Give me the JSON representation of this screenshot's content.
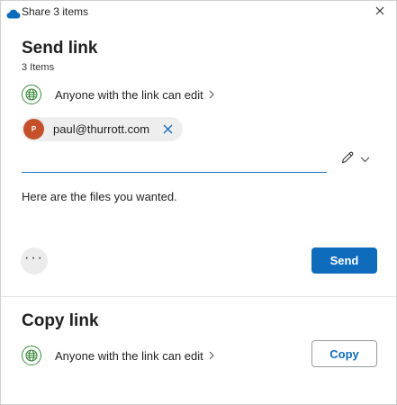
{
  "window": {
    "title": "Share 3 items"
  },
  "send_link": {
    "heading": "Send link",
    "items_count": "3 Items",
    "permission": "Anyone with the link can edit",
    "recipient": {
      "initial": "P",
      "email": "paul@thurrott.com"
    },
    "to_field_value": "",
    "message": "Here are the files you wanted.",
    "more_label": "···",
    "send_label": "Send"
  },
  "copy_link": {
    "heading": "Copy link",
    "permission": "Anyone with the link can edit",
    "copy_label": "Copy"
  },
  "icons": {
    "app": "onedrive-cloud-icon",
    "close": "close-icon",
    "globe": "globe-icon",
    "chevron_right": "chevron-right-icon",
    "remove": "remove-recipient-icon",
    "pencil": "pencil-icon",
    "chevron_down": "chevron-down-icon"
  },
  "colors": {
    "accent": "#0f6cbd",
    "avatar": "#c4512a",
    "globe": "#3c8a3c",
    "chip_bg": "#eeeeee",
    "underline": "#1f6fc5"
  }
}
